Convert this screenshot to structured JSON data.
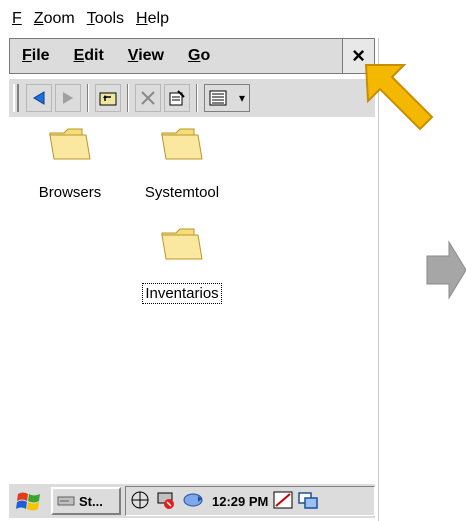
{
  "outer_menu": {
    "file": "File",
    "zoom": "Zoom",
    "tools": "Tools",
    "help": "Help"
  },
  "inner_menu": {
    "file": "File",
    "edit": "Edit",
    "view": "View",
    "go": "Go",
    "close": "×"
  },
  "toolbar": {
    "buttons": [
      "back-icon",
      "forward-icon",
      "up-folder-icon",
      "delete-icon",
      "properties-icon",
      "view-menu-icon"
    ],
    "view_dropdown_arrow": "▾"
  },
  "files": [
    {
      "name": "Browsers",
      "icon": "folder-icon"
    },
    {
      "name": "Systemtool",
      "icon": "folder-icon"
    },
    {
      "name": "Inventarios",
      "icon": "folder-icon",
      "focused": true
    }
  ],
  "taskbar": {
    "start_icon": "windows-flag-icon",
    "task_label": "St...",
    "clock": "12:29 PM"
  },
  "colors": {
    "highlight_arrow": "#f5b800",
    "next_arrow": "#a6a6a6",
    "folder": "#f7dc7a"
  }
}
